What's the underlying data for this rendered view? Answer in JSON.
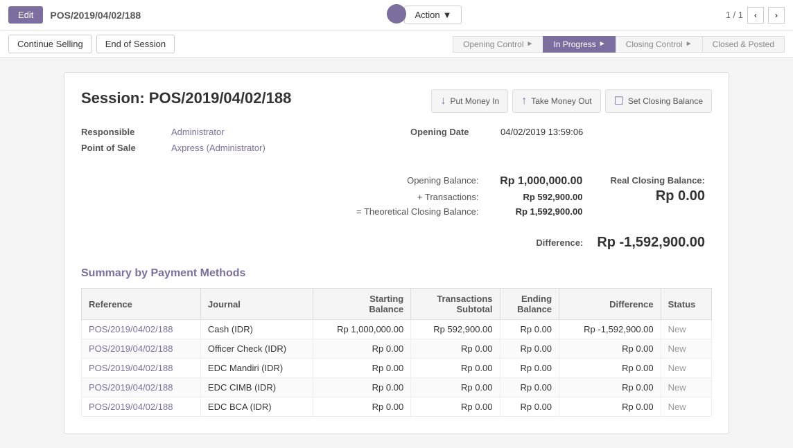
{
  "topbar": {
    "title": "POS/2019/04/02/188",
    "edit_label": "Edit",
    "action_label": "Action",
    "pagination": "1 / 1"
  },
  "status_bar": {
    "continue_selling": "Continue Selling",
    "end_of_session": "End of Session",
    "steps": [
      {
        "label": "Opening Control",
        "active": false
      },
      {
        "label": "In Progress",
        "active": true
      },
      {
        "label": "Closing Control",
        "active": false
      },
      {
        "label": "Closed & Posted",
        "active": false
      }
    ]
  },
  "session": {
    "title": "Session: POS/2019/04/02/188",
    "put_money_in": "Put Money In",
    "take_money_out": "Take Money Out",
    "set_closing_balance": "Set Closing Balance",
    "responsible_label": "Responsible",
    "responsible_value": "Administrator",
    "point_of_sale_label": "Point of Sale",
    "point_of_sale_value": "Axpress (Administrator)",
    "opening_date_label": "Opening Date",
    "opening_date_value": "04/02/2019 13:59:06",
    "opening_balance_label": "Opening Balance:",
    "opening_balance_value": "Rp 1,000,000.00",
    "transactions_label": "+ Transactions:",
    "transactions_value": "Rp 592,900.00",
    "theoretical_label": "= Theoretical Closing Balance:",
    "theoretical_value": "Rp 1,592,900.00",
    "real_closing_label": "Real Closing Balance:",
    "real_closing_value": "Rp 0.00",
    "difference_label": "Difference:",
    "difference_value": "Rp -1,592,900.00"
  },
  "summary": {
    "title": "Summary by Payment Methods",
    "columns": [
      "Reference",
      "Journal",
      "Starting Balance",
      "Transactions Subtotal",
      "Ending Balance",
      "Difference",
      "Status"
    ],
    "rows": [
      {
        "reference": "POS/2019/04/02/188",
        "journal": "Cash (IDR)",
        "starting_balance": "Rp 1,000,000.00",
        "transactions_subtotal": "Rp 592,900.00",
        "ending_balance": "Rp 0.00",
        "difference": "Rp -1,592,900.00",
        "status": "New"
      },
      {
        "reference": "POS/2019/04/02/188",
        "journal": "Officer Check (IDR)",
        "starting_balance": "Rp 0.00",
        "transactions_subtotal": "Rp 0.00",
        "ending_balance": "Rp 0.00",
        "difference": "Rp 0.00",
        "status": "New"
      },
      {
        "reference": "POS/2019/04/02/188",
        "journal": "EDC Mandiri (IDR)",
        "starting_balance": "Rp 0.00",
        "transactions_subtotal": "Rp 0.00",
        "ending_balance": "Rp 0.00",
        "difference": "Rp 0.00",
        "status": "New"
      },
      {
        "reference": "POS/2019/04/02/188",
        "journal": "EDC CIMB (IDR)",
        "starting_balance": "Rp 0.00",
        "transactions_subtotal": "Rp 0.00",
        "ending_balance": "Rp 0.00",
        "difference": "Rp 0.00",
        "status": "New"
      },
      {
        "reference": "POS/2019/04/02/188",
        "journal": "EDC BCA (IDR)",
        "starting_balance": "Rp 0.00",
        "transactions_subtotal": "Rp 0.00",
        "ending_balance": "Rp 0.00",
        "difference": "Rp 0.00",
        "status": "New"
      }
    ]
  }
}
